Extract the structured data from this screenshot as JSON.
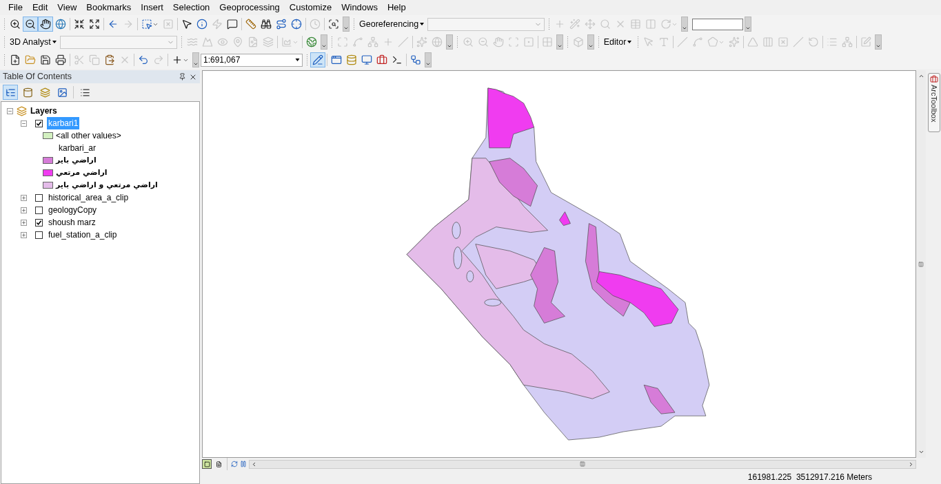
{
  "menu": [
    "File",
    "Edit",
    "View",
    "Bookmarks",
    "Insert",
    "Selection",
    "Geoprocessing",
    "Customize",
    "Windows",
    "Help"
  ],
  "toolbar_rows": [
    [
      {
        "kind": "tools",
        "groups": [
          [
            {
              "disabled": false,
              "selected": false,
              "dropdown": false
            },
            {
              "disabled": false,
              "selected": true,
              "dropdown": false
            },
            {
              "disabled": false,
              "selected": true,
              "dropdown": false
            },
            {
              "disabled": false,
              "selected": false,
              "dropdown": false
            }
          ],
          [
            {
              "disabled": false,
              "selected": false,
              "dropdown": false
            },
            {
              "disabled": false,
              "selected": false,
              "dropdown": false
            }
          ],
          [
            {
              "disabled": false,
              "selected": false,
              "dropdown": false
            },
            {
              "disabled": true,
              "selected": false,
              "dropdown": false
            }
          ],
          [
            {
              "disabled": false,
              "selected": false,
              "dropdown": true
            },
            {
              "disabled": true,
              "selected": false,
              "dropdown": false
            }
          ],
          [
            {
              "disabled": false,
              "selected": false,
              "dropdown": false
            },
            {
              "disabled": false,
              "selected": false,
              "dropdown": false
            },
            {
              "disabled": true,
              "selected": false,
              "dropdown": false
            },
            {
              "disabled": false,
              "selected": false,
              "dropdown": false
            }
          ],
          [
            {
              "disabled": false,
              "selected": false,
              "dropdown": false
            },
            {
              "disabled": false,
              "selected": false,
              "dropdown": false
            },
            {
              "disabled": false,
              "selected": false,
              "dropdown": false
            },
            {
              "disabled": false,
              "selected": false,
              "dropdown": false
            }
          ],
          [
            {
              "disabled": true,
              "selected": false,
              "dropdown": false
            }
          ],
          [
            {
              "disabled": false,
              "selected": false,
              "dropdown": false
            }
          ]
        ]
      },
      {
        "kind": "menu",
        "label": "Georeferencing"
      },
      {
        "kind": "combo",
        "disabled": true
      },
      {
        "kind": "tools",
        "groups": [
          [
            {
              "disabled": true,
              "selected": false,
              "dropdown": false
            },
            {
              "disabled": true,
              "selected": false,
              "dropdown": false
            },
            {
              "disabled": true,
              "selected": false,
              "dropdown": false
            },
            {
              "disabled": true,
              "selected": false,
              "dropdown": false
            },
            {
              "disabled": true,
              "selected": false,
              "dropdown": false
            },
            {
              "disabled": true,
              "selected": false,
              "dropdown": false
            },
            {
              "disabled": true,
              "selected": false,
              "dropdown": false
            },
            {
              "disabled": true,
              "selected": false,
              "dropdown": true
            }
          ]
        ]
      },
      {
        "kind": "input"
      }
    ],
    [
      {
        "kind": "menu",
        "label": "3D Analyst"
      },
      {
        "kind": "combo",
        "disabled": true
      },
      {
        "kind": "tools",
        "groups": [
          [
            {
              "disabled": true,
              "selected": false,
              "dropdown": false
            },
            {
              "disabled": true,
              "selected": false,
              "dropdown": false
            },
            {
              "disabled": true,
              "selected": false,
              "dropdown": false
            },
            {
              "disabled": true,
              "selected": false,
              "dropdown": false
            },
            {
              "disabled": true,
              "selected": false,
              "dropdown": false
            },
            {
              "disabled": true,
              "selected": false,
              "dropdown": false
            }
          ],
          [
            {
              "disabled": true,
              "selected": false,
              "dropdown": true
            }
          ],
          [
            {
              "disabled": false,
              "selected": false,
              "dropdown": false
            }
          ]
        ]
      },
      {
        "kind": "tools",
        "groups": [
          [
            {
              "disabled": true,
              "selected": false,
              "dropdown": false
            },
            {
              "disabled": true,
              "selected": false,
              "dropdown": false
            },
            {
              "disabled": true,
              "selected": false,
              "dropdown": false
            },
            {
              "disabled": true,
              "selected": false,
              "dropdown": false
            },
            {
              "disabled": true,
              "selected": false,
              "dropdown": false
            }
          ],
          [
            {
              "disabled": true,
              "selected": false,
              "dropdown": false
            },
            {
              "disabled": true,
              "selected": false,
              "dropdown": false
            }
          ]
        ]
      },
      {
        "kind": "tools",
        "groups": [
          [
            {
              "disabled": true,
              "selected": false,
              "dropdown": false
            },
            {
              "disabled": true,
              "selected": false,
              "dropdown": false
            },
            {
              "disabled": true,
              "selected": false,
              "dropdown": false
            },
            {
              "disabled": true,
              "selected": false,
              "dropdown": false
            },
            {
              "disabled": true,
              "selected": false,
              "dropdown": false
            }
          ],
          [
            {
              "disabled": true,
              "selected": false,
              "dropdown": false
            }
          ]
        ]
      },
      {
        "kind": "tools",
        "groups": [
          [
            {
              "disabled": true,
              "selected": false,
              "dropdown": false
            }
          ]
        ]
      },
      {
        "kind": "menu",
        "label": "Editor"
      },
      {
        "kind": "tools",
        "groups": [
          [
            {
              "disabled": true,
              "selected": false,
              "dropdown": false
            },
            {
              "disabled": true,
              "selected": false,
              "dropdown": false
            }
          ],
          [
            {
              "disabled": true,
              "selected": false,
              "dropdown": false
            },
            {
              "disabled": true,
              "selected": false,
              "dropdown": false
            },
            {
              "disabled": true,
              "selected": false,
              "dropdown": true
            },
            {
              "disabled": true,
              "selected": false,
              "dropdown": false
            }
          ],
          [
            {
              "disabled": true,
              "selected": false,
              "dropdown": false
            },
            {
              "disabled": true,
              "selected": false,
              "dropdown": false
            },
            {
              "disabled": true,
              "selected": false,
              "dropdown": false
            },
            {
              "disabled": true,
              "selected": false,
              "dropdown": false
            },
            {
              "disabled": true,
              "selected": false,
              "dropdown": false
            }
          ],
          [
            {
              "disabled": true,
              "selected": false,
              "dropdown": false
            },
            {
              "disabled": true,
              "selected": false,
              "dropdown": false
            }
          ],
          [
            {
              "disabled": true,
              "selected": false,
              "dropdown": false
            }
          ]
        ]
      }
    ],
    [
      {
        "kind": "tools",
        "groups": [
          [
            {
              "disabled": false,
              "selected": false,
              "dropdown": false
            },
            {
              "disabled": false,
              "selected": false,
              "dropdown": false
            },
            {
              "disabled": false,
              "selected": false,
              "dropdown": false
            },
            {
              "disabled": false,
              "selected": false,
              "dropdown": false
            }
          ],
          [
            {
              "disabled": true,
              "selected": false,
              "dropdown": false
            },
            {
              "disabled": true,
              "selected": false,
              "dropdown": false
            },
            {
              "disabled": false,
              "selected": false,
              "dropdown": false
            },
            {
              "disabled": true,
              "selected": false,
              "dropdown": false
            }
          ],
          [
            {
              "disabled": false,
              "selected": false,
              "dropdown": false
            },
            {
              "disabled": true,
              "selected": false,
              "dropdown": false
            }
          ],
          [
            {
              "disabled": false,
              "selected": false,
              "dropdown": true
            }
          ]
        ]
      },
      {
        "kind": "scale",
        "value": "1:691,067"
      },
      {
        "kind": "tools",
        "groups": [
          [
            {
              "disabled": false,
              "selected": true,
              "dropdown": false
            }
          ],
          [
            {
              "disabled": false,
              "selected": false,
              "dropdown": false
            },
            {
              "disabled": false,
              "selected": false,
              "dropdown": false
            },
            {
              "disabled": false,
              "selected": false,
              "dropdown": false
            },
            {
              "disabled": false,
              "selected": false,
              "dropdown": false
            },
            {
              "disabled": false,
              "selected": false,
              "dropdown": false
            }
          ],
          [
            {
              "disabled": false,
              "selected": false,
              "dropdown": false
            }
          ]
        ]
      }
    ]
  ],
  "toc": {
    "title": "Table Of Contents",
    "tools": [
      {
        "selected": true
      },
      {
        "selected": false
      },
      {
        "selected": false
      },
      {
        "selected": false
      },
      {
        "selected": false
      }
    ],
    "root": {
      "label": "Layers",
      "expanded": true
    },
    "layers": [
      {
        "name": "karbari1",
        "checked": true,
        "expanded": true,
        "selected": true,
        "legend": [
          {
            "kind": "swatch",
            "label": "<all other values>",
            "color": "#d3f0c0"
          },
          {
            "kind": "heading",
            "label": "karbari_ar"
          },
          {
            "kind": "swatch",
            "label": "اراضي باير",
            "color": "#d67cd8"
          },
          {
            "kind": "swatch",
            "label": "اراضي مرتعي",
            "color": "#f03cf0"
          },
          {
            "kind": "swatch",
            "label": "اراضي مرتعي و اراضي باير",
            "color": "#e4bce9"
          }
        ]
      },
      {
        "name": "historical_area_a_clip",
        "checked": false,
        "expanded": false,
        "selected": false
      },
      {
        "name": "geologyCopy",
        "checked": false,
        "expanded": false,
        "selected": false
      },
      {
        "name": "shoush marz",
        "checked": true,
        "expanded": false,
        "selected": false
      },
      {
        "name": "fuel_station_a_clip",
        "checked": false,
        "expanded": false,
        "selected": false
      }
    ]
  },
  "side_tab": {
    "label": "ArcToolbox"
  },
  "map_views": [
    {
      "selected": true
    },
    {
      "selected": false
    }
  ],
  "status_bar": {
    "coordinates": "161981.225  3512917.216 Meters"
  }
}
